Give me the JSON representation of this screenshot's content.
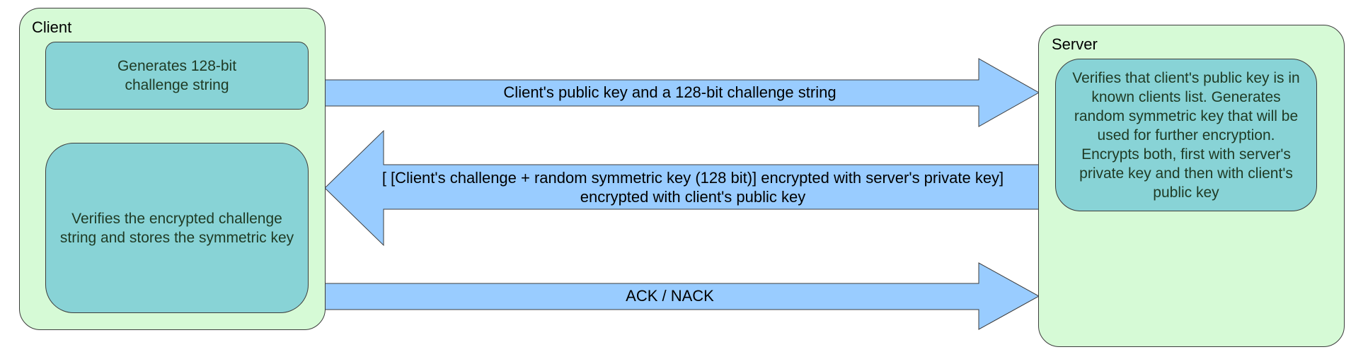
{
  "client": {
    "title": "Client",
    "step_generate": "Generates 128-bit challenge string",
    "step_verify": "Verifies the encrypted challenge string and stores the symmetric key"
  },
  "server": {
    "title": "Server",
    "step_verify": "Verifies that client's public key is in known clients list. Generates random symmetric key that will be used for further encryption. Encrypts both, first with server's private key and then with client's public key"
  },
  "messages": {
    "client_to_server": "Client's public key and a 128-bit challenge string",
    "server_to_client_line1": "[ [Client's challenge + random symmetric key (128 bit)] encrypted with server's private key]",
    "server_to_client_line2": "encrypted with client's public key",
    "ack": "ACK / NACK"
  },
  "colors": {
    "panel_fill": "#d6fad6",
    "step_fill": "#88d3d6",
    "arrow_fill": "#99ccff",
    "outline": "#3c3c3c"
  }
}
